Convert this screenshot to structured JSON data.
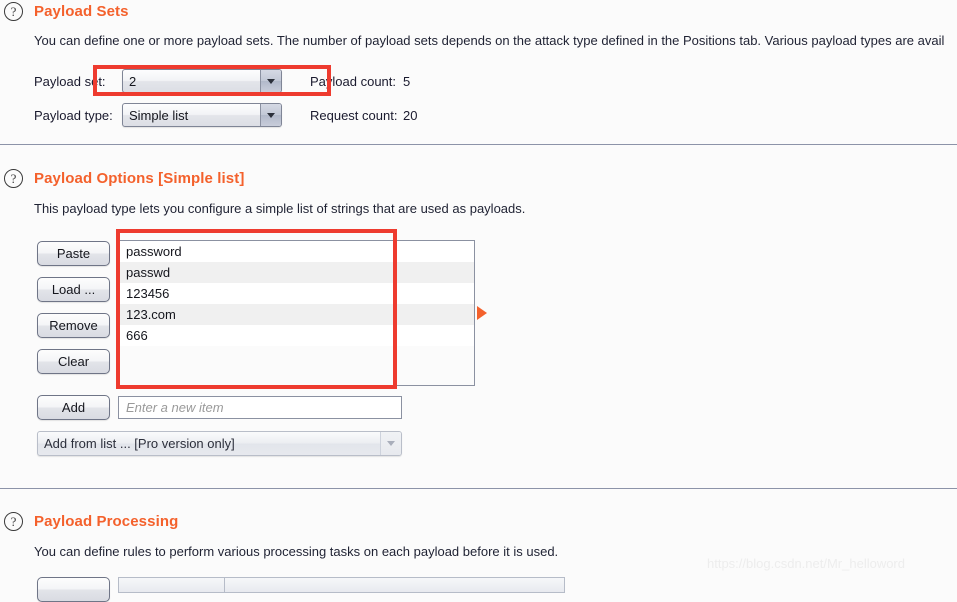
{
  "sections": {
    "payload_sets": {
      "icon": "help-circle-icon",
      "title": "Payload Sets",
      "description": "You can define one or more payload sets. The number of payload sets depends on the attack type defined in the Positions tab. Various payload types are avail",
      "payload_set_label": "Payload set:",
      "payload_set_value": "2",
      "payload_count_label": "Payload count:",
      "payload_count_value": "5",
      "payload_type_label": "Payload type:",
      "payload_type_value": "Simple list",
      "request_count_label": "Request count:",
      "request_count_value": "20"
    },
    "payload_options": {
      "icon": "help-circle-icon",
      "title": "Payload Options [Simple list]",
      "description": "This payload type lets you configure a simple list of strings that are used as payloads.",
      "buttons": [
        {
          "name": "paste-button",
          "label": "Paste"
        },
        {
          "name": "load-button",
          "label": "Load ..."
        },
        {
          "name": "remove-button",
          "label": "Remove"
        },
        {
          "name": "clear-button",
          "label": "Clear"
        }
      ],
      "payload_items": [
        "password",
        "passwd",
        "123456",
        "123.com",
        "666"
      ],
      "add_button_label": "Add",
      "new_item_placeholder": "Enter a new item",
      "new_item_value": "",
      "add_from_list_label": "Add from list ... [Pro version only]",
      "marker_icon": "play-triangle-icon"
    },
    "payload_processing": {
      "icon": "help-circle-icon",
      "title": "Payload Processing",
      "description": "You can define rules to perform various processing tasks on each payload before it is used."
    }
  },
  "annotations": {
    "colors": {
      "highlight": "#ee3b2f",
      "accent": "#f4612c",
      "divider": "#8c93a8",
      "background": "#fbfbfb"
    }
  },
  "watermark": {
    "text": "https://blog.csdn.net/Mr_helloword"
  }
}
